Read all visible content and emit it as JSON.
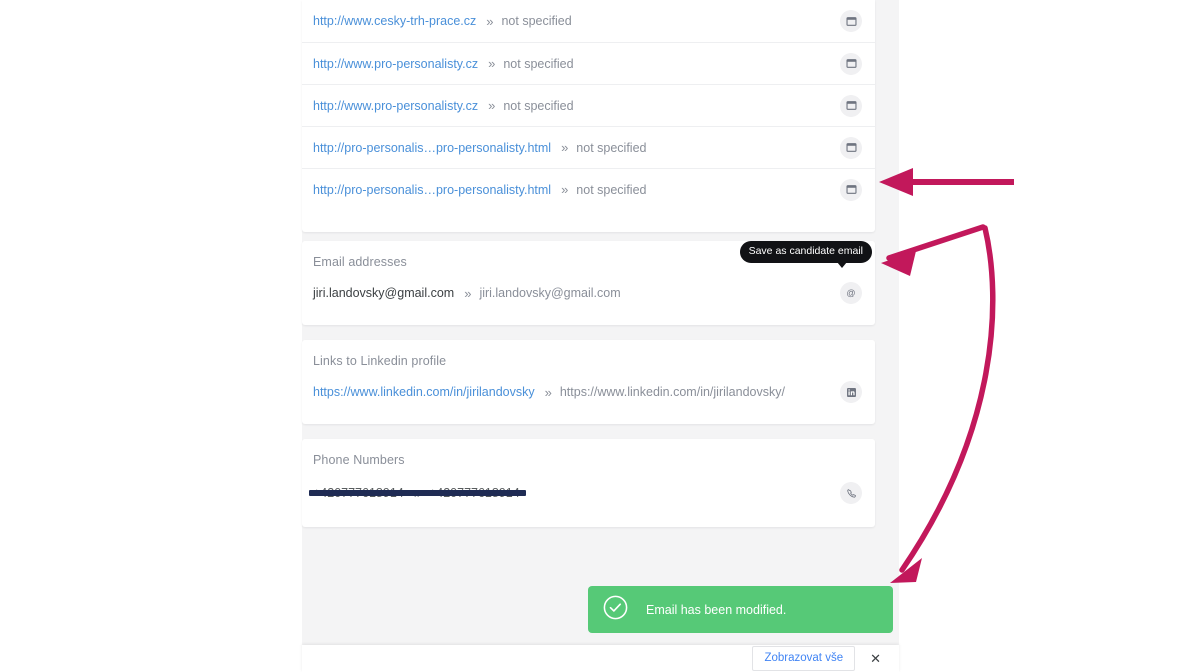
{
  "accent": {
    "link": "#4a90d9",
    "annotation": "#c2185b",
    "toast_bg": "#56c977",
    "muted": "#8a8f99",
    "redaction": "#1f2b54"
  },
  "source_links_card": {
    "rows": [
      {
        "source": "http://www.cesky-trh-prace.cz",
        "separator": "»",
        "value": "not specified",
        "action_icon": "browser-window-icon"
      },
      {
        "source": "http://www.pro-personalisty.cz",
        "separator": "»",
        "value": "not specified",
        "action_icon": "browser-window-icon"
      },
      {
        "source": "http://www.pro-personalisty.cz",
        "separator": "»",
        "value": "not specified",
        "action_icon": "browser-window-icon"
      },
      {
        "source": "http://pro-personalis…pro-personalisty.html",
        "separator": "»",
        "value": "not specified",
        "action_icon": "browser-window-icon"
      },
      {
        "source": "http://pro-personalis…pro-personalisty.html",
        "separator": "»",
        "value": "not specified",
        "action_icon": "browser-window-icon"
      }
    ]
  },
  "email_card": {
    "title": "Email addresses",
    "rows": [
      {
        "source": "jiri.landovsky@gmail.com",
        "separator": "»",
        "value": "jiri.landovsky@gmail.com",
        "action_icon": "at-sign-icon"
      }
    ],
    "tooltip": "Save as candidate email"
  },
  "linkedin_card": {
    "title": "Links to Linkedin profile",
    "rows": [
      {
        "source": "https://www.linkedin.com/in/jirilandovsky",
        "separator": "»",
        "value": "https://www.linkedin.com/in/jirilandovsky/",
        "action_icon": "linkedin-icon"
      }
    ]
  },
  "phone_card": {
    "title": "Phone Numbers",
    "rows": [
      {
        "source": "+420777618914",
        "separator": "»",
        "value": "+420777618914",
        "action_icon": "phone-icon",
        "redacted": true
      }
    ]
  },
  "toast": {
    "icon": "check-circle-icon",
    "message": "Email has been modified."
  },
  "bottom_bar": {
    "show_all_label": "Zobrazovat vše",
    "close_label": "✕"
  }
}
